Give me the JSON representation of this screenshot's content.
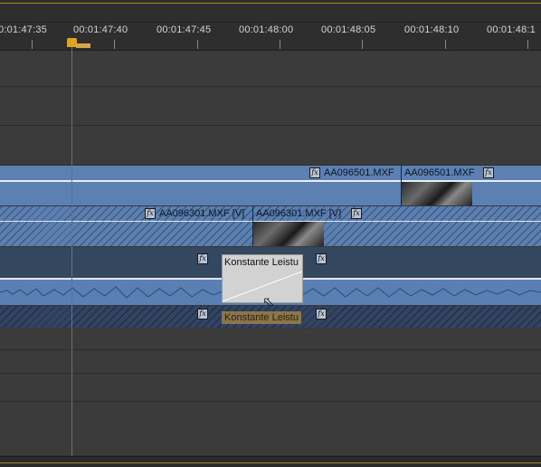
{
  "ruler": {
    "timecodes": [
      "0:01:47:35",
      "00:01:47:40",
      "00:01:47:45",
      "00:01:48:00",
      "00:01:48:05",
      "00:01:48:10",
      "00:01:48:1"
    ]
  },
  "tracks": {
    "video_clip_a1": "AA096501.MXF",
    "video_clip_a2": "AA096501.MXF",
    "video_clip_b1": "AA096301.MXF [V]",
    "video_clip_b2": "AA096301.MXF [V]"
  },
  "transitions": {
    "audio_transition_label": "Konstante Leistu",
    "audio_transition_label_lower": "Konstante Leistu"
  },
  "icons": {
    "fx": "fx",
    "playhead_marker": "playhead-marker-icon",
    "cursor": "mouse-pointer-icon"
  },
  "colors": {
    "video_track": "#5d80b2",
    "audio_track": "#5a7fb3",
    "playhead": "#c2503f",
    "playhead_marker": "#e0a520"
  }
}
